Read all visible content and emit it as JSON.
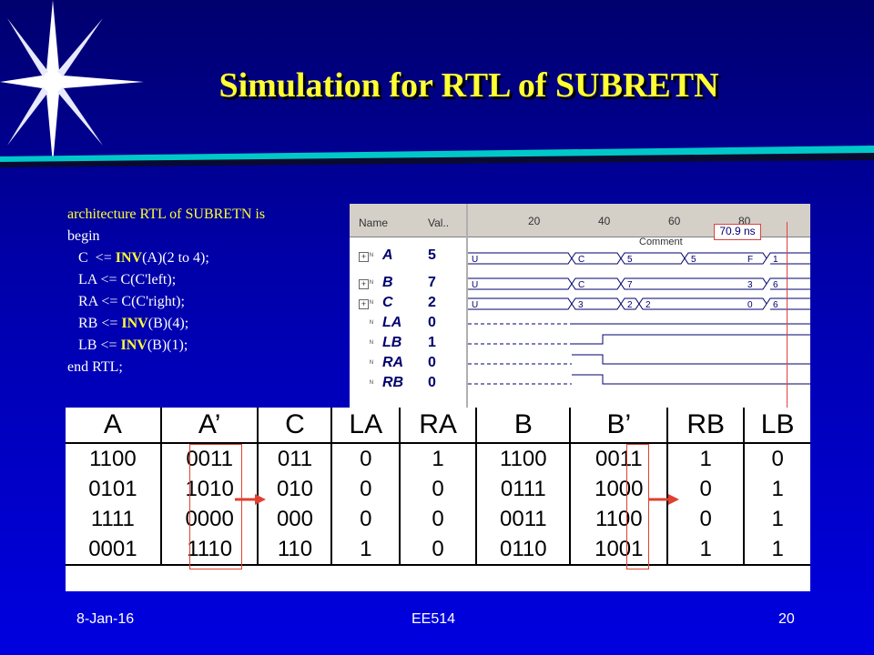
{
  "slide": {
    "title": "Simulation for RTL of SUBRETN",
    "footer_date": "8-Jan-16",
    "footer_course": "EE514",
    "footer_page": "20",
    "colors": {
      "background": "#0000c0",
      "title": "#ffff33",
      "text": "#ffffff",
      "accent": "#00cccc",
      "highlight": "#e04030"
    }
  },
  "code": {
    "lines": [
      "architecture RTL of SUBRETN is",
      "begin",
      "   C  <= INV(A)(2 to 4);",
      "   LA <= C(C'left);",
      "   RA <= C(C'right);",
      "   RB <= INV(B)(4);",
      "   LB <= INV(B)(1);",
      "end RTL;"
    ]
  },
  "waveform": {
    "column_name": "Name",
    "column_value": "Val..",
    "cursor_time": "70.9 ns",
    "comment_label": "Comment",
    "ticks": [
      "20",
      "40",
      "60",
      "80"
    ],
    "signals": [
      {
        "name": "A",
        "value": "5",
        "bus": true,
        "segments": [
          "U",
          "C",
          "5",
          "5",
          "F",
          "1"
        ]
      },
      {
        "name": "B",
        "value": "7",
        "bus": true,
        "segments": [
          "U",
          "C",
          "7",
          "3",
          "6"
        ]
      },
      {
        "name": "C",
        "value": "2",
        "bus": true,
        "segments": [
          "U",
          "3",
          "2",
          "2",
          "0",
          "6"
        ]
      },
      {
        "name": "LA",
        "value": "0",
        "bus": false
      },
      {
        "name": "LB",
        "value": "1",
        "bus": false
      },
      {
        "name": "RA",
        "value": "0",
        "bus": false
      },
      {
        "name": "RB",
        "value": "0",
        "bus": false
      }
    ]
  },
  "truth_table": {
    "headers": [
      "A",
      "A’",
      "C",
      "LA",
      "RA",
      "B",
      "B’",
      "RB",
      "LB"
    ],
    "rows": [
      [
        "1100",
        "0011",
        "011",
        "0",
        "1",
        "1100",
        "0011",
        "1",
        "0"
      ],
      [
        "0101",
        "1010",
        "010",
        "0",
        "0",
        "0111",
        "1000",
        "0",
        "1"
      ],
      [
        "1111",
        "0000",
        "000",
        "0",
        "0",
        "0011",
        "1100",
        "0",
        "1"
      ],
      [
        "0001",
        "1110",
        "110",
        "1",
        "0",
        "0110",
        "1001",
        "1",
        "1"
      ]
    ]
  }
}
